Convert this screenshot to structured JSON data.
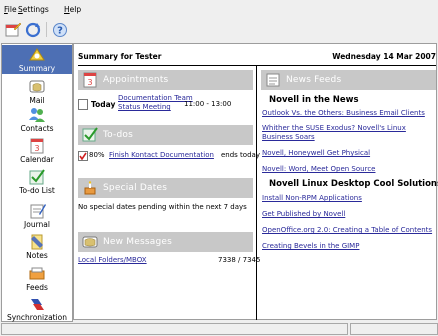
{
  "menubar": {
    "items": [
      {
        "label": "ile",
        "mnemonic": "F"
      },
      {
        "label": "ettings",
        "mnemonic": "S"
      },
      {
        "label": "elp",
        "mnemonic": "H"
      }
    ]
  },
  "toolbar": {
    "buttons": [
      {
        "icon": "new-entry-icon"
      },
      {
        "icon": "sync-refresh-icon"
      },
      {
        "icon": "help-icon"
      }
    ]
  },
  "sidebar": {
    "items": [
      {
        "label": "Summary",
        "icon": "summary-icon",
        "active": true
      },
      {
        "label": "Mail",
        "icon": "mail-icon"
      },
      {
        "label": "Contacts",
        "icon": "contacts-icon"
      },
      {
        "label": "Calendar",
        "icon": "calendar-icon"
      },
      {
        "label": "To-do List",
        "icon": "todo-icon"
      },
      {
        "label": "Journal",
        "icon": "journal-icon"
      },
      {
        "label": "Notes",
        "icon": "notes-icon"
      },
      {
        "label": "Feeds",
        "icon": "feeds-icon"
      },
      {
        "label": "Synchronization",
        "icon": "synchronization-icon"
      }
    ]
  },
  "summary": {
    "title": "Summary for Tester",
    "date": "Wednesday 14 Mar 2007"
  },
  "appointments": {
    "title": "Appointments",
    "items": [
      {
        "day": "Today",
        "summary_line1": "Documentation Team",
        "summary_line2": "Status Meeting",
        "time": "11:00 - 13:00"
      }
    ]
  },
  "todos": {
    "title": "To-dos",
    "items": [
      {
        "percent": "80%",
        "summary": "Finish Kontact Documentation",
        "due": "ends today"
      }
    ]
  },
  "special_dates": {
    "title": "Special Dates",
    "empty_text": "No special dates pending within the next 7 days"
  },
  "new_messages": {
    "title": "New Messages",
    "items": [
      {
        "folder": "Local Folders/MBOX",
        "count": "7338 / 7345"
      }
    ]
  },
  "news_feeds": {
    "title": "News Feeds",
    "feeds": [
      {
        "title": "Novell in the News",
        "articles": [
          "Outlook Vs. the Others: Business Email Clients",
          "Whither the SUSE Exodus? Novell's Linux",
          "Business Soars",
          "Novell, Honeywell Get Physical",
          "Novell: Word, Meet Open Source"
        ]
      },
      {
        "title": "Novell Linux Desktop Cool Solutions",
        "articles": [
          "Install Non-RPM Applications",
          "Get Published by Novell",
          "OpenOffice.org 2.0: Creating a Table of Contents",
          "Creating Bevels in the GIMP"
        ]
      }
    ]
  },
  "colors": {
    "sidebar_active": "#4d6fb4",
    "section_header": "#c8c8c8",
    "link": "#2a2a9a"
  }
}
